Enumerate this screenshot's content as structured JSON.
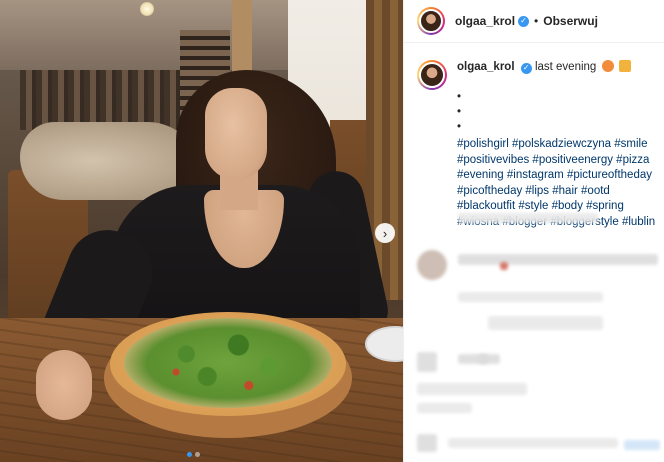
{
  "post": {
    "carousel": {
      "slide_count": 2,
      "active_index": 1
    }
  },
  "header": {
    "username": "olgaa_krol",
    "separator": "•",
    "follow_label": "Obserwuj"
  },
  "caption": {
    "username": "olgaa_krol",
    "text": "last evening",
    "bullets": [
      "•",
      "•",
      "•"
    ],
    "hashtags": "#polishgirl #polskadziewczyna #smile #positivevibes #positiveenergy #pizza #evening #instagram #pictureoftheday #picoftheday #lips #hair #ootd #blackoutfit #style #body #spring #wiosna #blogger #bloggerstyle #lublin"
  },
  "icons": {
    "verified": "verified-badge-icon",
    "next": "chevron-right-icon",
    "emoji_1": "peach-emoji-icon",
    "emoji_2": "pizza-emoji-icon"
  },
  "colors": {
    "verified": "#3897f0",
    "hashtag": "#00376b",
    "text": "#262626"
  }
}
